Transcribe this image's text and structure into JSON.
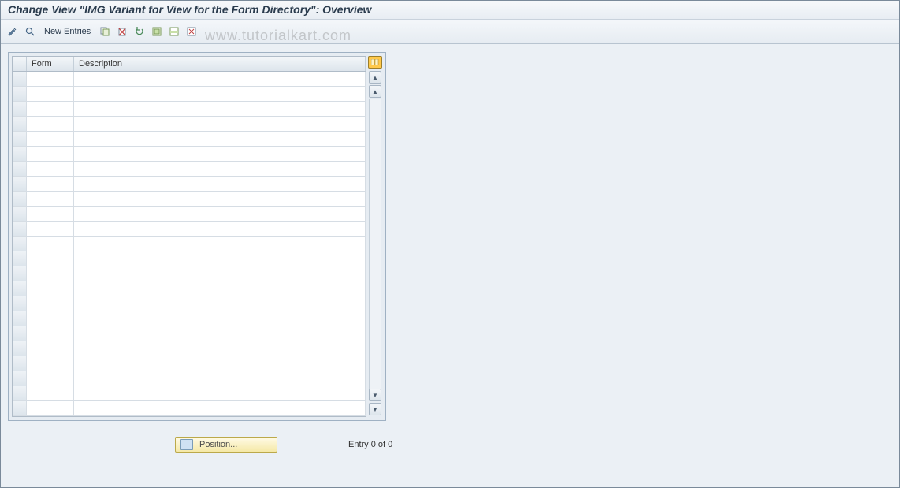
{
  "title": "Change View \"IMG Variant for View for the Form Directory\": Overview",
  "toolbar": {
    "new_entries_label": "New Entries"
  },
  "table": {
    "columns": {
      "form": "Form",
      "description": "Description"
    },
    "rows": [
      {
        "form": "",
        "description": ""
      },
      {
        "form": "",
        "description": ""
      },
      {
        "form": "",
        "description": ""
      },
      {
        "form": "",
        "description": ""
      },
      {
        "form": "",
        "description": ""
      },
      {
        "form": "",
        "description": ""
      },
      {
        "form": "",
        "description": ""
      },
      {
        "form": "",
        "description": ""
      },
      {
        "form": "",
        "description": ""
      },
      {
        "form": "",
        "description": ""
      },
      {
        "form": "",
        "description": ""
      },
      {
        "form": "",
        "description": ""
      },
      {
        "form": "",
        "description": ""
      },
      {
        "form": "",
        "description": ""
      },
      {
        "form": "",
        "description": ""
      },
      {
        "form": "",
        "description": ""
      },
      {
        "form": "",
        "description": ""
      },
      {
        "form": "",
        "description": ""
      },
      {
        "form": "",
        "description": ""
      },
      {
        "form": "",
        "description": ""
      },
      {
        "form": "",
        "description": ""
      },
      {
        "form": "",
        "description": ""
      },
      {
        "form": "",
        "description": ""
      }
    ]
  },
  "footer": {
    "position_label": "Position...",
    "entry_text": "Entry 0 of 0"
  },
  "watermark": "www.tutorialkart.com"
}
